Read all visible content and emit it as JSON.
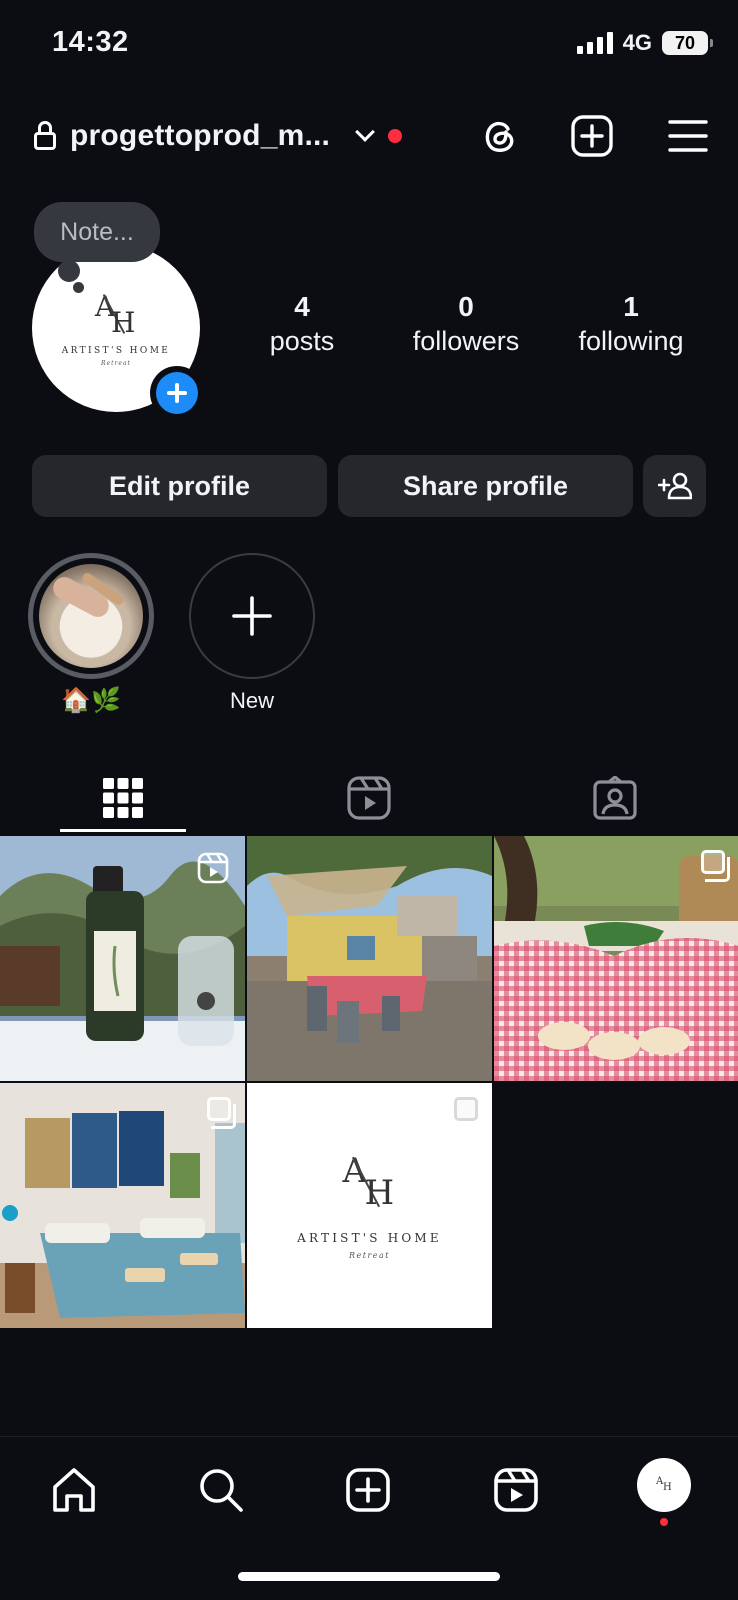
{
  "status_bar": {
    "time": "14:32",
    "network": "4G",
    "battery": "70"
  },
  "header": {
    "username": "progettoprod_m..."
  },
  "note": {
    "placeholder": "Note..."
  },
  "profile": {
    "logo_text": "ARTIST'S HOME",
    "logo_sub": "Retreat",
    "logo_mark_a": "A",
    "logo_mark_h": "H"
  },
  "stats": [
    {
      "value": "4",
      "label": "posts"
    },
    {
      "value": "0",
      "label": "followers"
    },
    {
      "value": "1",
      "label": "following"
    }
  ],
  "buttons": {
    "edit": "Edit profile",
    "share": "Share profile"
  },
  "highlights": [
    {
      "label": "🏠🌿"
    },
    {
      "label": "New"
    }
  ],
  "tabs": [
    "grid-icon",
    "reels-icon",
    "tagged-icon"
  ],
  "grid": [
    {
      "kind": "reel",
      "subject": "olive oil bottle and carafe"
    },
    {
      "kind": "photo",
      "subject": "garden table under olive trees"
    },
    {
      "kind": "carousel",
      "subject": "gingham cloth with pasta"
    },
    {
      "kind": "carousel",
      "subject": "bedroom with blue bed"
    },
    {
      "kind": "carousel",
      "subject": "Artist's Home logo"
    }
  ],
  "nav": [
    "home-icon",
    "search-icon",
    "create-icon",
    "reels-icon",
    "profile-avatar"
  ]
}
